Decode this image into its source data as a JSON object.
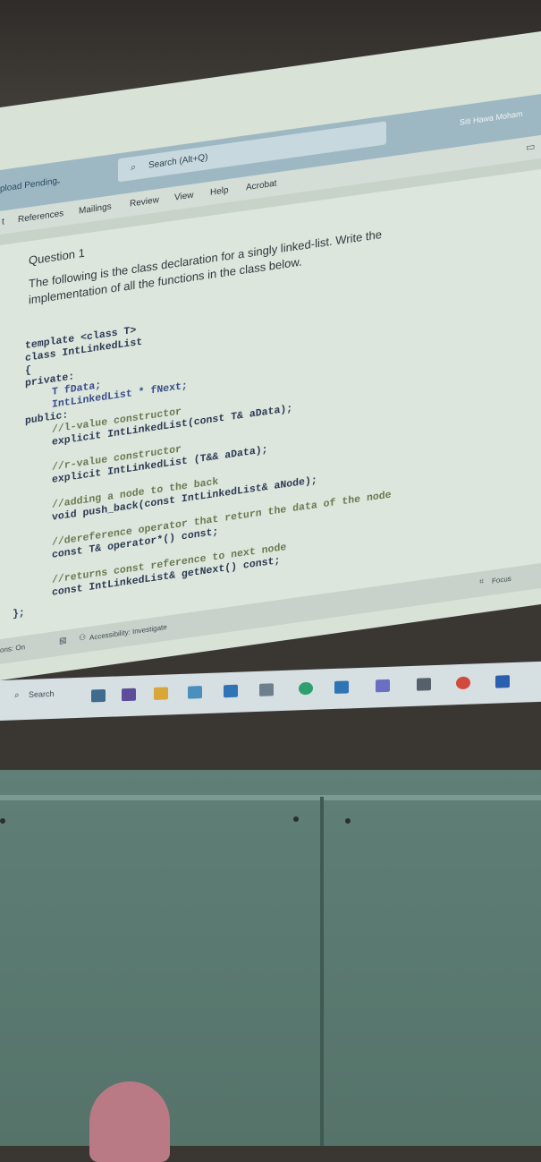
{
  "titlebar": {
    "upload_status": "pload Pending",
    "search_placeholder": "Search (Alt+Q)",
    "user_name": "Siti Hawa Moham"
  },
  "ribbon": {
    "tabs": [
      "t",
      "References",
      "Mailings",
      "Review",
      "View",
      "Help",
      "Acrobat"
    ]
  },
  "document": {
    "heading": "Question 1",
    "prompt_line1": "The following is the class declaration for a singly linked-list. Write the",
    "prompt_line2": "implementation of all the functions in the class below.",
    "code": {
      "template": "template <class T>",
      "class_decl": "class IntLinkedList",
      "open_brace": "{",
      "private_label": "private:",
      "field_data": "T fData;",
      "field_next": "IntLinkedList * fNext;",
      "public_label": "public:",
      "c1": "//l-value constructor",
      "s1": "explicit IntLinkedList(const T& aData);",
      "c2": "//r-value constructor",
      "s2": "explicit IntLinkedList (T&& aData);",
      "c3": "//adding a node to the back",
      "s3": "void push_back(const IntLinkedList& aNode);",
      "c4": "//dereference operator that return the data of the node",
      "s4": "const T& operator*() const;",
      "c5": "//returns const reference to next node",
      "s5": "const IntLinkedList& getNext() const;",
      "close": "};"
    }
  },
  "statusbar": {
    "left": "ons: On",
    "accessibility": "Accessibility: Investigate",
    "focus": "Focus"
  },
  "taskbar": {
    "search": "Search"
  },
  "colors": {
    "screen_bg": "#dce6dc",
    "ribbon_top": "#9db8c3",
    "whiteboard": "#5f7f77"
  }
}
